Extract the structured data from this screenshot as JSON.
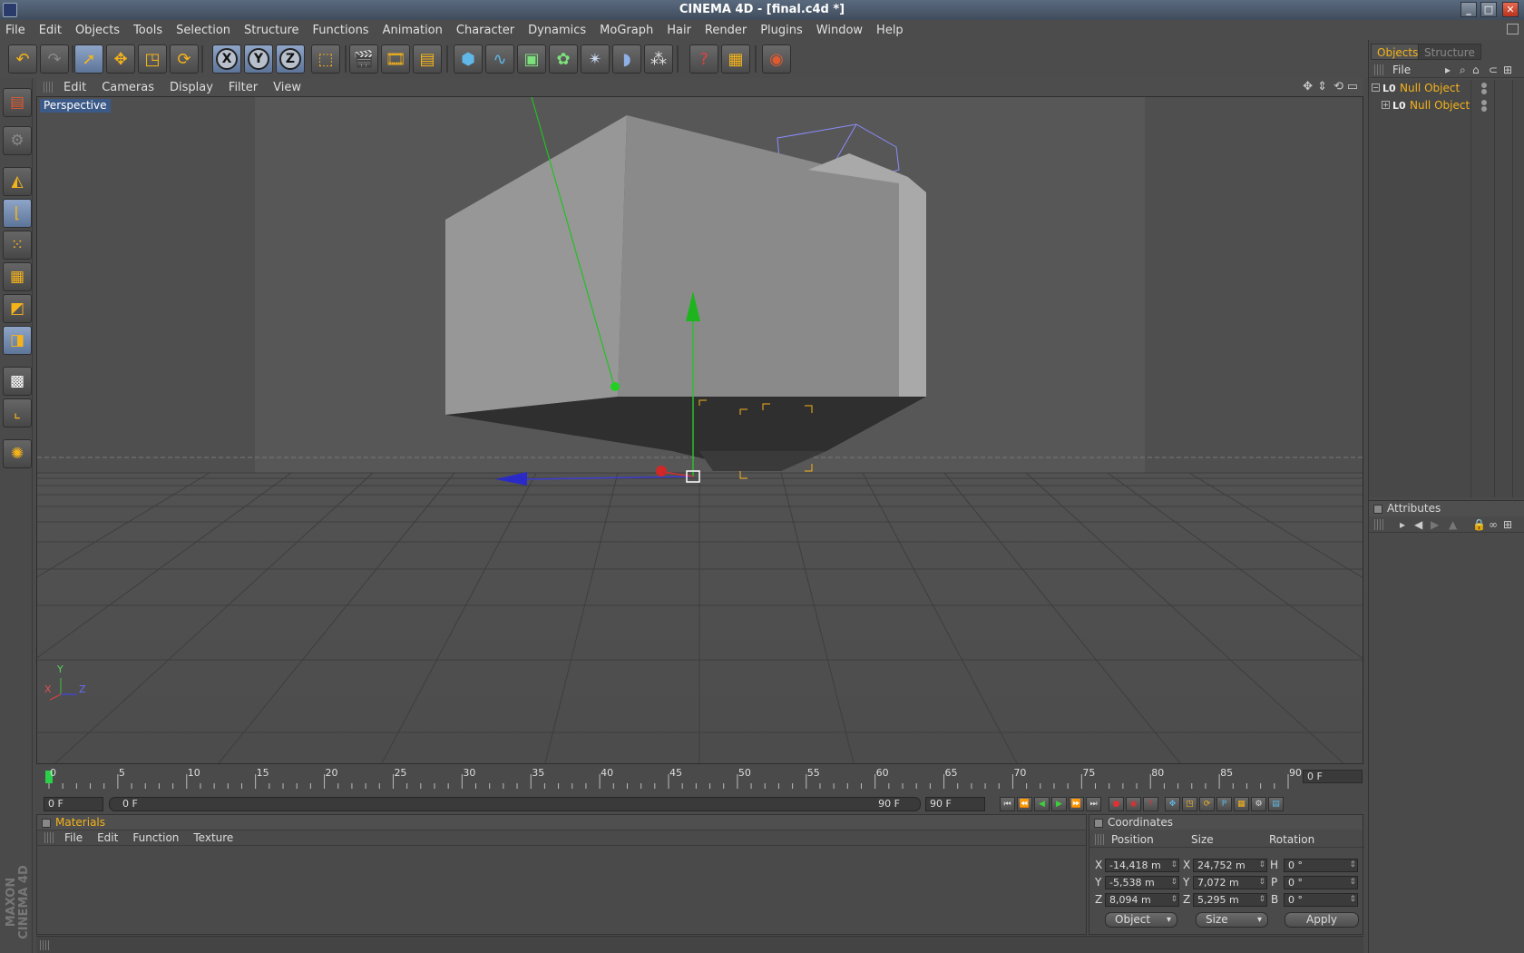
{
  "window": {
    "title": "CINEMA 4D - [final.c4d *]",
    "minimize": "_",
    "maximize": "□",
    "close": "✕"
  },
  "menubar": [
    "File",
    "Edit",
    "Objects",
    "Tools",
    "Selection",
    "Structure",
    "Functions",
    "Animation",
    "Character",
    "Dynamics",
    "MoGraph",
    "Hair",
    "Render",
    "Plugins",
    "Window",
    "Help"
  ],
  "toolbar": {
    "axis_x": "X",
    "axis_y": "Y",
    "axis_z": "Z"
  },
  "viewport": {
    "menu": [
      "Edit",
      "Cameras",
      "Display",
      "Filter",
      "View"
    ],
    "label": "Perspective",
    "axis_y": "Y",
    "axis_x": "X",
    "axis_z": "Z"
  },
  "timeline": {
    "ticks": [
      "0",
      "5",
      "10",
      "15",
      "20",
      "25",
      "30",
      "35",
      "40",
      "45",
      "50",
      "55",
      "60",
      "65",
      "70",
      "75",
      "80",
      "85",
      "90"
    ],
    "current_frame": "0 F",
    "start_field": "0 F",
    "range_start": "0 F",
    "range_end": "90 F",
    "end_field": "90 F"
  },
  "materials": {
    "title": "Materials",
    "menu": [
      "File",
      "Edit",
      "Function",
      "Texture"
    ]
  },
  "coordinates": {
    "title": "Coordinates",
    "headers": [
      "Position",
      "Size",
      "Rotation"
    ],
    "rows": [
      {
        "axis": "X",
        "position": "-14,418 m",
        "size_axis": "X",
        "size": "24,752 m",
        "rot_axis": "H",
        "rotation": "0 °"
      },
      {
        "axis": "Y",
        "position": "-5,538 m",
        "size_axis": "Y",
        "size": "7,072 m",
        "rot_axis": "P",
        "rotation": "0 °"
      },
      {
        "axis": "Z",
        "position": "8,094 m",
        "size_axis": "Z",
        "size": "5,295 m",
        "rot_axis": "B",
        "rotation": "0 °"
      }
    ],
    "mode_dropdown": "Object",
    "size_dropdown": "Size",
    "apply": "Apply"
  },
  "right_panel": {
    "tabs": [
      "Objects",
      "Structure"
    ],
    "menu": "File",
    "objects": [
      {
        "name": "Null Object",
        "icon": "L0",
        "expander": "−"
      },
      {
        "name": "Null Object",
        "icon": "L0",
        "expander": "+"
      }
    ],
    "attributes_title": "Attributes"
  },
  "branding": {
    "line1": "MAXON",
    "line2": "CINEMA 4D"
  },
  "colors": {
    "accent": "#f5b31a",
    "panel": "#4a4a4a",
    "viewport": "#575757",
    "selected_tool": "#7a93b8"
  }
}
